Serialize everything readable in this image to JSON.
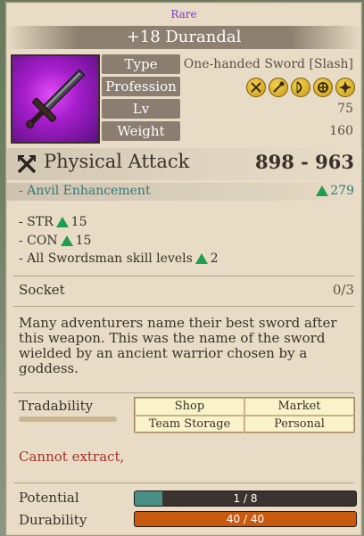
{
  "item": {
    "rarity": "Rare",
    "name": "+18 Durandal",
    "icon": "sword-icon",
    "rarity_color": "#7a37c9"
  },
  "properties": {
    "type_label": "Type",
    "type_value": "One-handed Sword [Slash]",
    "profession_label": "Profession",
    "profession_icons": [
      "swordsman-class-icon",
      "wizard-class-icon",
      "archer-class-icon",
      "cleric-class-icon",
      "scout-class-icon"
    ],
    "level_label": "Lv",
    "level_value": "75",
    "weight_label": "Weight",
    "weight_value": "160"
  },
  "attack": {
    "label": "Physical Attack",
    "value": "898 - 963",
    "icon": "crossed-swords-icon"
  },
  "anvil": {
    "label": "- Anvil Enhancement",
    "value": "279",
    "color": "#2f7c73"
  },
  "bonuses": [
    {
      "label": "- STR",
      "value": "15"
    },
    {
      "label": "- CON",
      "value": "15"
    },
    {
      "label": "- All Swordsman skill levels",
      "value": "2"
    }
  ],
  "socket": {
    "label": "Socket",
    "value": "0/3"
  },
  "description": "Many adventurers name their best sword after this weapon. This was the name of the sword wielded by an ancient warrior chosen by a goddess.",
  "tradability": {
    "label": "Tradability",
    "options": [
      "Shop",
      "Market",
      "Team Storage",
      "Personal"
    ]
  },
  "extract_note": "Cannot extract,",
  "potential": {
    "label": "Potential",
    "text": "1 / 8",
    "current": 1,
    "max": 8,
    "color": "#4a8f86"
  },
  "durability": {
    "label": "Durability",
    "text": "40 / 40",
    "current": 40,
    "max": 40,
    "color": "#c85a10"
  }
}
